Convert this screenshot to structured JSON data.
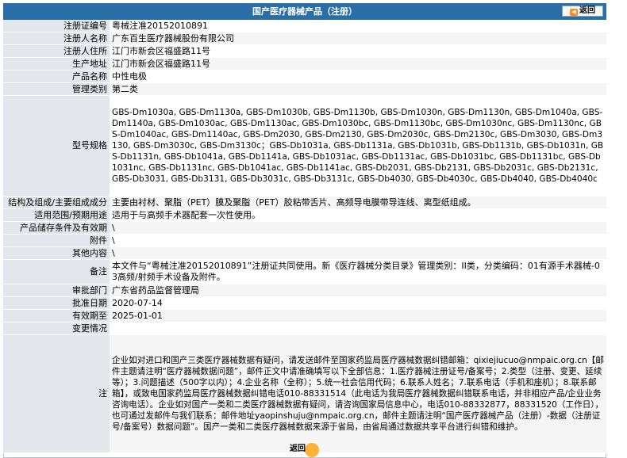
{
  "header": {
    "title": "国产医疗器械产品（注册）",
    "back_label": "返回"
  },
  "rows": [
    {
      "label": "注册证编号",
      "value": "粤械注准20152010891"
    },
    {
      "label": "注册人名称",
      "value": "广东百生医疗器械股份有限公司"
    },
    {
      "label": "注册人住所",
      "value": "江门市新会区福盛路11号"
    },
    {
      "label": "生产地址",
      "value": "江门市新会区福盛路11号"
    },
    {
      "label": "产品名称",
      "value": "中性电极"
    },
    {
      "label": "管理类别",
      "value": "第二类"
    },
    {
      "label": "型号规格",
      "value": "GBS-Dm1030a, GBS-Dm1130a, GBS-Dm1030b, GBS-Dm1130b, GBS-Dm1030n, GBS-Dm1130n, GBS-Dm1040a, GBS-Dm1140a, GBS-Dm1030ac, GBS-Dm1130ac, GBS-Dm1030bc, GBS-Dm1130bc, GBS-Dm1030nc, GBS-Dm1130nc, GBS-Dm1040ac, GBS-Dm1140ac, GBS-Dm2030, GBS-Dm2130, GBS-Dm2030c, GBS-Dm2130c, GBS-Dm3030, GBS-Dm3130, GBS-Dm3030c, GBS-Dm3130c；GBS-Db1031a, GBS-Db1131a, GBS-Db1031b, GBS-Db1131b, GBS-Db1031n, GBS-Db1131n, GBS-Db1041a, GBS-Db1141a, GBS-Db1031ac, GBS-Db1131ac, GBS-Db1031bc, GBS-Db1131bc, GBS-Db1031nc, GBS-Db1131nc, GBS-Db1041ac, GBS-Db1141ac, GBS-Db2031, GBS-Db2131, GBS-Db2031c, GBS-Db2131c, GBS-Db3031, GBS-Db3131, GBS-Db3031c, GBS-Db3131c, GBS-Db4030, GBS-Db4030c, GBS-Db4040, GBS-Db4040c"
    },
    {
      "label": "结构及组成/主要组成成分",
      "value": "主要由衬材、聚脂（PET）膜及聚脂（PET）胶粘带舌片、高频导电膜带导连线、离型纸组成。"
    },
    {
      "label": "适用范围/预期用途",
      "value": "适用于与高频手术器配套一次性使用。"
    },
    {
      "label": "产品储存条件及有效期",
      "value": "\\"
    },
    {
      "label": "附件",
      "value": "\\"
    },
    {
      "label": "其他内容",
      "value": "\\"
    },
    {
      "label": "备注",
      "value": "本文件与“粤械注准20152010891”注册证共同使用。新《医疗器械分类目录》管理类别：II类，分类编码：01有源手术器械-03高频/射频手术设备及附件。"
    },
    {
      "label": "审批部门",
      "value": "广东省药品监督管理局"
    },
    {
      "label": "批准日期",
      "value": "2020-07-14"
    },
    {
      "label": "有效期至",
      "value": "2025-01-01"
    },
    {
      "label": "变更情况",
      "value": ""
    },
    {
      "label": "注",
      "value": "企业如对进口和国产三类医疗器械数据有疑问，请发送邮件至国家药监局医疗器械数据纠错邮箱：qixiejiucuo@nmpaic.org.cn【邮件主题请注明“医疗器械数据问题”，邮件正文中请准确填写以下全部信息：1.医疗器械注册证号/备案号；2.类型（注册、变更、延续等）；3.问题描述（500字以内）；4.企业名称（全称）；5.统一社会信用代码；6.联系人姓名；7.联系电话（手机和座机）；8.联系邮箱】，或致电国家药监局医疗器械数据纠错电话010-88331514（此电话为我局医疗器械数据纠错联系电话，并非相应产品/企业业务咨询电话）。企业如对国产一类和二类医疗器械数据有疑问，请咨询国家局信息中心，电话010-88332877，88331520（工作日），也可通过发邮件与我们联系：邮件地址yaopinshuju@nmpaic.org.cn，邮件主题请注明“国产医疗器械产品（注册）-数据（注册证号/备案号）数据问题”。国产一类和二类医疗器械数据来源于省局，由省局通过数据共享平台进行纠错和维护。"
    }
  ],
  "footer": {
    "back_label": "返回"
  }
}
